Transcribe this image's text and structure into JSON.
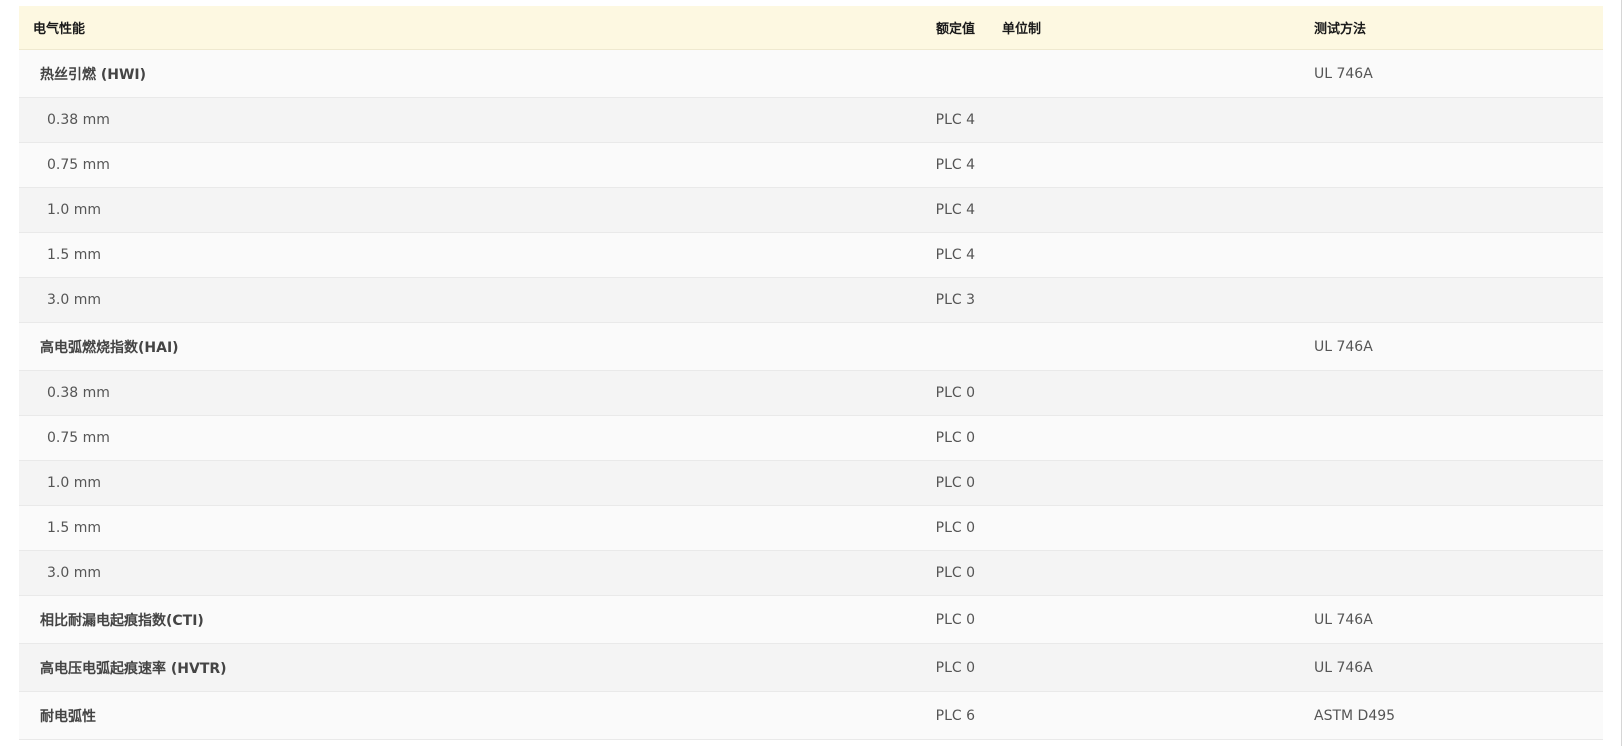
{
  "table": {
    "headers": {
      "property": "电气性能",
      "value": "额定值",
      "unit": "单位制",
      "test": "测试方法"
    },
    "rows": [
      {
        "type": "group",
        "property": "热丝引燃 (HWI)",
        "value": "",
        "unit": "",
        "test": "UL 746A"
      },
      {
        "type": "sub",
        "property": "0.38 mm",
        "value": "PLC 4",
        "unit": "",
        "test": ""
      },
      {
        "type": "sub",
        "property": "0.75 mm",
        "value": "PLC 4",
        "unit": "",
        "test": ""
      },
      {
        "type": "sub",
        "property": "1.0 mm",
        "value": "PLC 4",
        "unit": "",
        "test": ""
      },
      {
        "type": "sub",
        "property": "1.5 mm",
        "value": "PLC 4",
        "unit": "",
        "test": ""
      },
      {
        "type": "sub",
        "property": "3.0 mm",
        "value": "PLC 3",
        "unit": "",
        "test": ""
      },
      {
        "type": "group",
        "property": "高电弧燃烧指数(HAI)",
        "value": "",
        "unit": "",
        "test": "UL 746A"
      },
      {
        "type": "sub",
        "property": "0.38 mm",
        "value": "PLC 0",
        "unit": "",
        "test": ""
      },
      {
        "type": "sub",
        "property": "0.75 mm",
        "value": "PLC 0",
        "unit": "",
        "test": ""
      },
      {
        "type": "sub",
        "property": "1.0 mm",
        "value": "PLC 0",
        "unit": "",
        "test": ""
      },
      {
        "type": "sub",
        "property": "1.5 mm",
        "value": "PLC 0",
        "unit": "",
        "test": ""
      },
      {
        "type": "sub",
        "property": "3.0 mm",
        "value": "PLC 0",
        "unit": "",
        "test": ""
      },
      {
        "type": "group",
        "property": "相比耐漏电起痕指数(CTI)",
        "value": "PLC 0",
        "unit": "",
        "test": "UL 746A"
      },
      {
        "type": "group",
        "property": "高电压电弧起痕速率 (HVTR)",
        "value": "PLC 0",
        "unit": "",
        "test": "UL 746A"
      },
      {
        "type": "group",
        "property": "耐电弧性",
        "value": "PLC 6",
        "unit": "",
        "test": "ASTM D495"
      }
    ]
  }
}
